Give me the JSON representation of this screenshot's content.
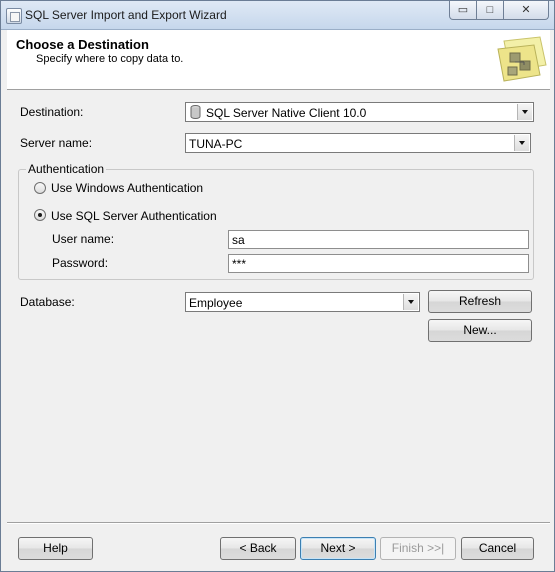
{
  "window": {
    "title": "SQL Server Import and Export Wizard",
    "controls": {
      "minimize": "▭",
      "maximize": "□",
      "close": "✕"
    }
  },
  "header": {
    "title": "Choose a Destination",
    "subtitle": "Specify where to copy data to."
  },
  "form": {
    "destination_label": "Destination:",
    "destination_value": "SQL Server Native Client 10.0",
    "server_label": "Server name:",
    "server_value": "TUNA-PC",
    "auth_group_label": "Authentication",
    "auth_windows_label": "Use Windows Authentication",
    "auth_sql_label": "Use SQL Server Authentication",
    "username_label": "User name:",
    "username_value": "sa",
    "password_label": "Password:",
    "password_value": "***",
    "database_label": "Database:",
    "database_value": "Employee",
    "refresh_label": "Refresh",
    "new_label": "New..."
  },
  "footer": {
    "help_label": "Help",
    "back_label": "< Back",
    "next_label": "Next >",
    "finish_label": "Finish >>|",
    "cancel_label": "Cancel"
  },
  "colors": {
    "titlebar": "#c6d7ec",
    "dialog_bg": "#f0f0f0",
    "default_button_border": "#3c7fb1"
  },
  "icons": [
    "app-icon",
    "database-icon",
    "wizard-destination-icon",
    "chevron-down-icon"
  ]
}
